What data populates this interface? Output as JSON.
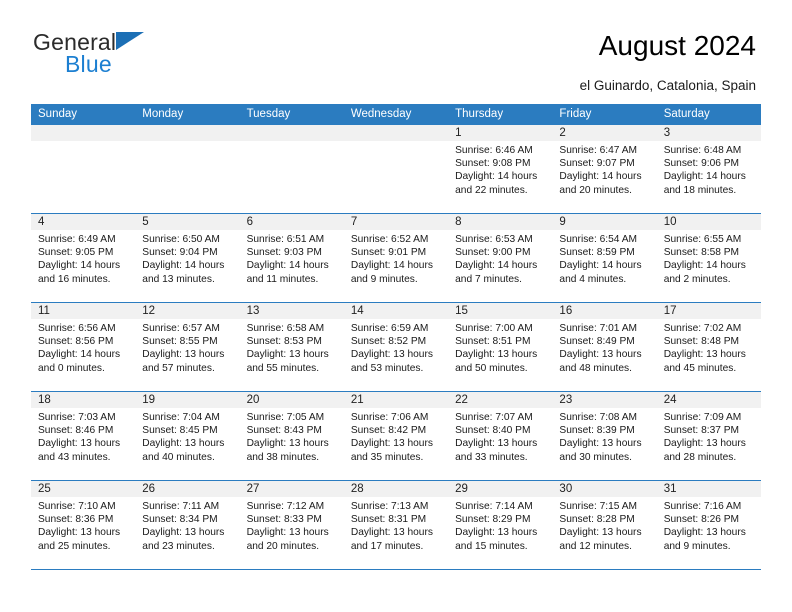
{
  "brand": {
    "name_part1": "General",
    "name_part2": "Blue",
    "mark_icon": "triangle-flag-icon"
  },
  "header": {
    "title": "August 2024",
    "location": "el Guinardo, Catalonia, Spain"
  },
  "theme": {
    "header_blue": "#2b7cc0",
    "band_gray": "#f1f1f1",
    "brand_blue": "#1c7fd1"
  },
  "weekdays": [
    "Sunday",
    "Monday",
    "Tuesday",
    "Wednesday",
    "Thursday",
    "Friday",
    "Saturday"
  ],
  "weeks": [
    [
      {
        "empty": true
      },
      {
        "empty": true
      },
      {
        "empty": true
      },
      {
        "empty": true
      },
      {
        "date": "1",
        "sunrise": "Sunrise: 6:46 AM",
        "sunset": "Sunset: 9:08 PM",
        "daylight1": "Daylight: 14 hours",
        "daylight2": "and 22 minutes."
      },
      {
        "date": "2",
        "sunrise": "Sunrise: 6:47 AM",
        "sunset": "Sunset: 9:07 PM",
        "daylight1": "Daylight: 14 hours",
        "daylight2": "and 20 minutes."
      },
      {
        "date": "3",
        "sunrise": "Sunrise: 6:48 AM",
        "sunset": "Sunset: 9:06 PM",
        "daylight1": "Daylight: 14 hours",
        "daylight2": "and 18 minutes."
      }
    ],
    [
      {
        "date": "4",
        "sunrise": "Sunrise: 6:49 AM",
        "sunset": "Sunset: 9:05 PM",
        "daylight1": "Daylight: 14 hours",
        "daylight2": "and 16 minutes."
      },
      {
        "date": "5",
        "sunrise": "Sunrise: 6:50 AM",
        "sunset": "Sunset: 9:04 PM",
        "daylight1": "Daylight: 14 hours",
        "daylight2": "and 13 minutes."
      },
      {
        "date": "6",
        "sunrise": "Sunrise: 6:51 AM",
        "sunset": "Sunset: 9:03 PM",
        "daylight1": "Daylight: 14 hours",
        "daylight2": "and 11 minutes."
      },
      {
        "date": "7",
        "sunrise": "Sunrise: 6:52 AM",
        "sunset": "Sunset: 9:01 PM",
        "daylight1": "Daylight: 14 hours",
        "daylight2": "and 9 minutes."
      },
      {
        "date": "8",
        "sunrise": "Sunrise: 6:53 AM",
        "sunset": "Sunset: 9:00 PM",
        "daylight1": "Daylight: 14 hours",
        "daylight2": "and 7 minutes."
      },
      {
        "date": "9",
        "sunrise": "Sunrise: 6:54 AM",
        "sunset": "Sunset: 8:59 PM",
        "daylight1": "Daylight: 14 hours",
        "daylight2": "and 4 minutes."
      },
      {
        "date": "10",
        "sunrise": "Sunrise: 6:55 AM",
        "sunset": "Sunset: 8:58 PM",
        "daylight1": "Daylight: 14 hours",
        "daylight2": "and 2 minutes."
      }
    ],
    [
      {
        "date": "11",
        "sunrise": "Sunrise: 6:56 AM",
        "sunset": "Sunset: 8:56 PM",
        "daylight1": "Daylight: 14 hours",
        "daylight2": "and 0 minutes."
      },
      {
        "date": "12",
        "sunrise": "Sunrise: 6:57 AM",
        "sunset": "Sunset: 8:55 PM",
        "daylight1": "Daylight: 13 hours",
        "daylight2": "and 57 minutes."
      },
      {
        "date": "13",
        "sunrise": "Sunrise: 6:58 AM",
        "sunset": "Sunset: 8:53 PM",
        "daylight1": "Daylight: 13 hours",
        "daylight2": "and 55 minutes."
      },
      {
        "date": "14",
        "sunrise": "Sunrise: 6:59 AM",
        "sunset": "Sunset: 8:52 PM",
        "daylight1": "Daylight: 13 hours",
        "daylight2": "and 53 minutes."
      },
      {
        "date": "15",
        "sunrise": "Sunrise: 7:00 AM",
        "sunset": "Sunset: 8:51 PM",
        "daylight1": "Daylight: 13 hours",
        "daylight2": "and 50 minutes."
      },
      {
        "date": "16",
        "sunrise": "Sunrise: 7:01 AM",
        "sunset": "Sunset: 8:49 PM",
        "daylight1": "Daylight: 13 hours",
        "daylight2": "and 48 minutes."
      },
      {
        "date": "17",
        "sunrise": "Sunrise: 7:02 AM",
        "sunset": "Sunset: 8:48 PM",
        "daylight1": "Daylight: 13 hours",
        "daylight2": "and 45 minutes."
      }
    ],
    [
      {
        "date": "18",
        "sunrise": "Sunrise: 7:03 AM",
        "sunset": "Sunset: 8:46 PM",
        "daylight1": "Daylight: 13 hours",
        "daylight2": "and 43 minutes."
      },
      {
        "date": "19",
        "sunrise": "Sunrise: 7:04 AM",
        "sunset": "Sunset: 8:45 PM",
        "daylight1": "Daylight: 13 hours",
        "daylight2": "and 40 minutes."
      },
      {
        "date": "20",
        "sunrise": "Sunrise: 7:05 AM",
        "sunset": "Sunset: 8:43 PM",
        "daylight1": "Daylight: 13 hours",
        "daylight2": "and 38 minutes."
      },
      {
        "date": "21",
        "sunrise": "Sunrise: 7:06 AM",
        "sunset": "Sunset: 8:42 PM",
        "daylight1": "Daylight: 13 hours",
        "daylight2": "and 35 minutes."
      },
      {
        "date": "22",
        "sunrise": "Sunrise: 7:07 AM",
        "sunset": "Sunset: 8:40 PM",
        "daylight1": "Daylight: 13 hours",
        "daylight2": "and 33 minutes."
      },
      {
        "date": "23",
        "sunrise": "Sunrise: 7:08 AM",
        "sunset": "Sunset: 8:39 PM",
        "daylight1": "Daylight: 13 hours",
        "daylight2": "and 30 minutes."
      },
      {
        "date": "24",
        "sunrise": "Sunrise: 7:09 AM",
        "sunset": "Sunset: 8:37 PM",
        "daylight1": "Daylight: 13 hours",
        "daylight2": "and 28 minutes."
      }
    ],
    [
      {
        "date": "25",
        "sunrise": "Sunrise: 7:10 AM",
        "sunset": "Sunset: 8:36 PM",
        "daylight1": "Daylight: 13 hours",
        "daylight2": "and 25 minutes."
      },
      {
        "date": "26",
        "sunrise": "Sunrise: 7:11 AM",
        "sunset": "Sunset: 8:34 PM",
        "daylight1": "Daylight: 13 hours",
        "daylight2": "and 23 minutes."
      },
      {
        "date": "27",
        "sunrise": "Sunrise: 7:12 AM",
        "sunset": "Sunset: 8:33 PM",
        "daylight1": "Daylight: 13 hours",
        "daylight2": "and 20 minutes."
      },
      {
        "date": "28",
        "sunrise": "Sunrise: 7:13 AM",
        "sunset": "Sunset: 8:31 PM",
        "daylight1": "Daylight: 13 hours",
        "daylight2": "and 17 minutes."
      },
      {
        "date": "29",
        "sunrise": "Sunrise: 7:14 AM",
        "sunset": "Sunset: 8:29 PM",
        "daylight1": "Daylight: 13 hours",
        "daylight2": "and 15 minutes."
      },
      {
        "date": "30",
        "sunrise": "Sunrise: 7:15 AM",
        "sunset": "Sunset: 8:28 PM",
        "daylight1": "Daylight: 13 hours",
        "daylight2": "and 12 minutes."
      },
      {
        "date": "31",
        "sunrise": "Sunrise: 7:16 AM",
        "sunset": "Sunset: 8:26 PM",
        "daylight1": "Daylight: 13 hours",
        "daylight2": "and 9 minutes."
      }
    ]
  ]
}
